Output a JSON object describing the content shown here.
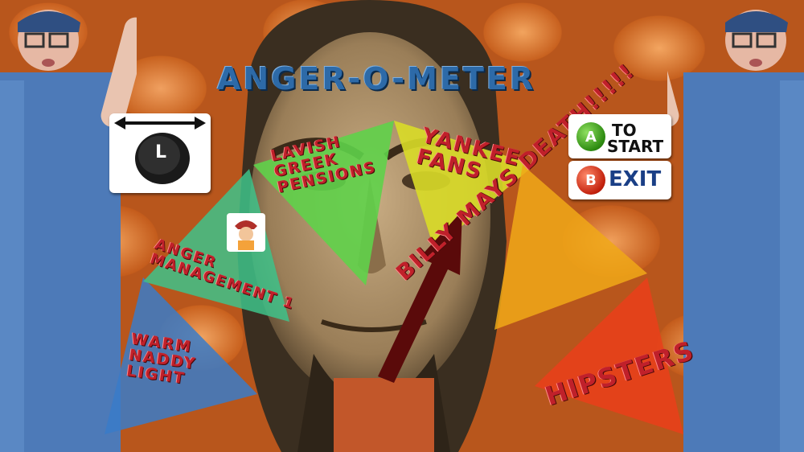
{
  "title": "ANGER-O-METER",
  "controls": {
    "l_button_label": "L",
    "a_button_label": "A",
    "a_action_line1": "TO",
    "a_action_line2": "START",
    "b_button_label": "B",
    "b_action": "EXIT"
  },
  "meter_slices": [
    {
      "line1": "WARM",
      "line2": "NADDY",
      "line3": "LIGHT",
      "color": "#3a7bc8"
    },
    {
      "line1": "ANGER",
      "line2": "MANAGEMENT 1",
      "color": "#3ec28a"
    },
    {
      "line1": "LAVISH",
      "line2": "GREEK",
      "line3": "PENSIONS",
      "color": "#5fd14a"
    },
    {
      "line1": "YANKEE",
      "line2": "FANS",
      "color": "#d9dc28"
    },
    {
      "line1": "BILLY MAYS DEATH!!!!!",
      "color": "#f0a818"
    },
    {
      "line1": "HIPSTERS",
      "color": "#e8401a"
    }
  ],
  "colors": {
    "title": "#2d6aa8",
    "label": "#c0202a",
    "needle": "#5a0a0a",
    "background": "#c8611f"
  }
}
